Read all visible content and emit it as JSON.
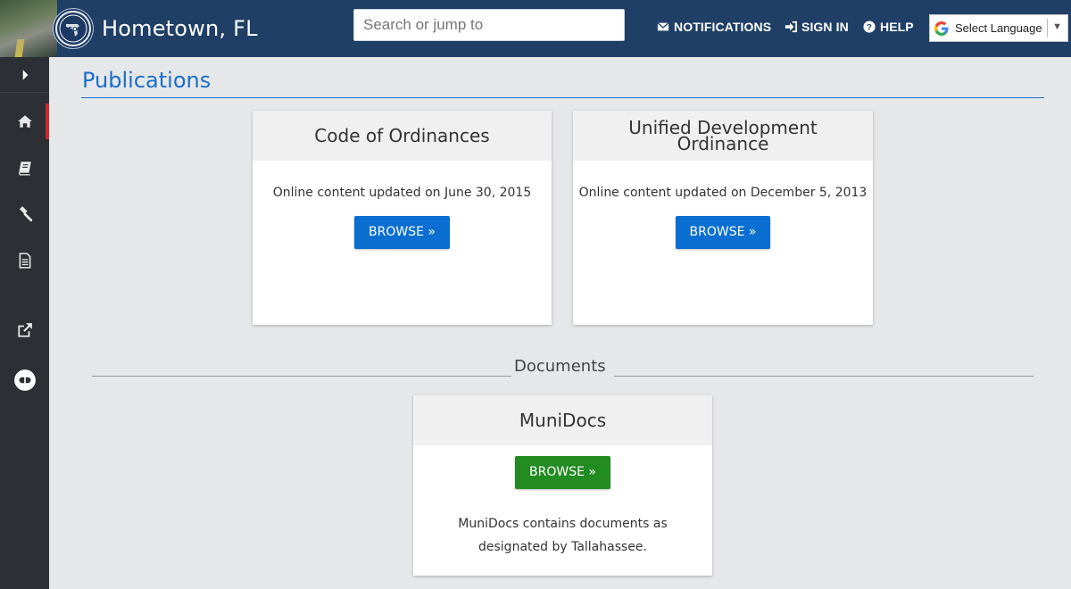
{
  "header": {
    "site_title": "Hometown, FL",
    "seal_text": "LEON",
    "search_placeholder": "Search or jump to",
    "nav": {
      "notifications": "NOTIFICATIONS",
      "sign_in": "SIGN IN",
      "help": "HELP"
    },
    "language_select": "Select Language"
  },
  "sidebar": {
    "items": [
      {
        "icon": "chevron-right-icon"
      },
      {
        "icon": "home-icon",
        "active": true
      },
      {
        "icon": "books-icon"
      },
      {
        "icon": "gavel-icon"
      },
      {
        "icon": "document-icon"
      },
      {
        "icon": "external-link-icon"
      },
      {
        "icon": "chat-icon"
      }
    ]
  },
  "main": {
    "page_title": "Publications",
    "publications": [
      {
        "title": "Code of Ordinances",
        "updated": "Online content updated on June 30, 2015",
        "button": "BROWSE »"
      },
      {
        "title": "Unified Development Ordinance",
        "updated": "Online content updated on December 5, 2013",
        "button": "BROWSE »"
      }
    ],
    "documents": {
      "section_title": "Documents",
      "card": {
        "title": "MuniDocs",
        "button": "BROWSE »",
        "description": "MuniDocs contains documents as designated by Tallahassee."
      }
    }
  },
  "colors": {
    "header_bg": "#1f3f66",
    "sidebar_bg": "#2c2f33",
    "accent_blue": "#1a6fc9",
    "button_blue": "#0a6fd1",
    "button_green": "#228b22",
    "active_marker": "#d0262f"
  }
}
